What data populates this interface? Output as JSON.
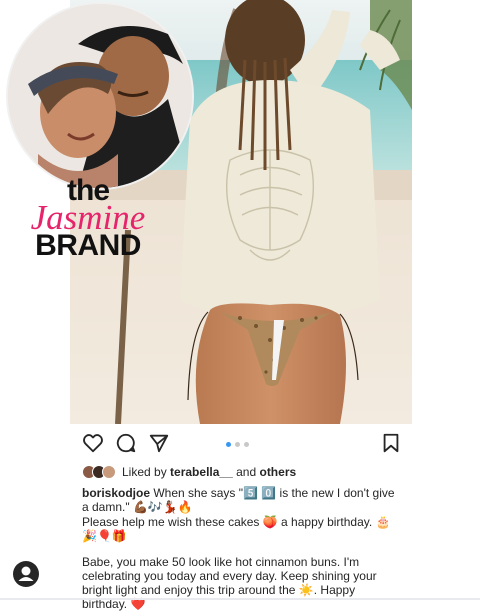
{
  "brand": {
    "the": "the",
    "jasmine": "Jasmine",
    "brand": "BRAND"
  },
  "carousel": {
    "total": 3,
    "active": 0
  },
  "likes": {
    "prefix": "Liked by",
    "user": "terabella__",
    "and": "and",
    "others": "others"
  },
  "caption": {
    "username": "boriskodjoe",
    "line1": " When she says \"5️⃣ 0️⃣ is the new I don't give a damn.\" 💪🏾🎶💃🏽🔥",
    "line2": "Please help me wish these cakes 🍑 a happy birthday. 🎂🎉🎈🎁",
    "line3": "Babe, you make 50 look like hot cinnamon buns. I'm celebrating you today and every day. Keep shining your bright light and enjoy this trip around the ☀️. Happy birthday. ❤️"
  },
  "icons": {
    "like": "heart-icon",
    "comment": "comment-icon",
    "share": "share-icon",
    "save": "bookmark-icon",
    "profile": "user-avatar-icon"
  },
  "colors": {
    "accent": "#3897f0",
    "brand_pink": "#e6246b",
    "text": "#262626"
  }
}
